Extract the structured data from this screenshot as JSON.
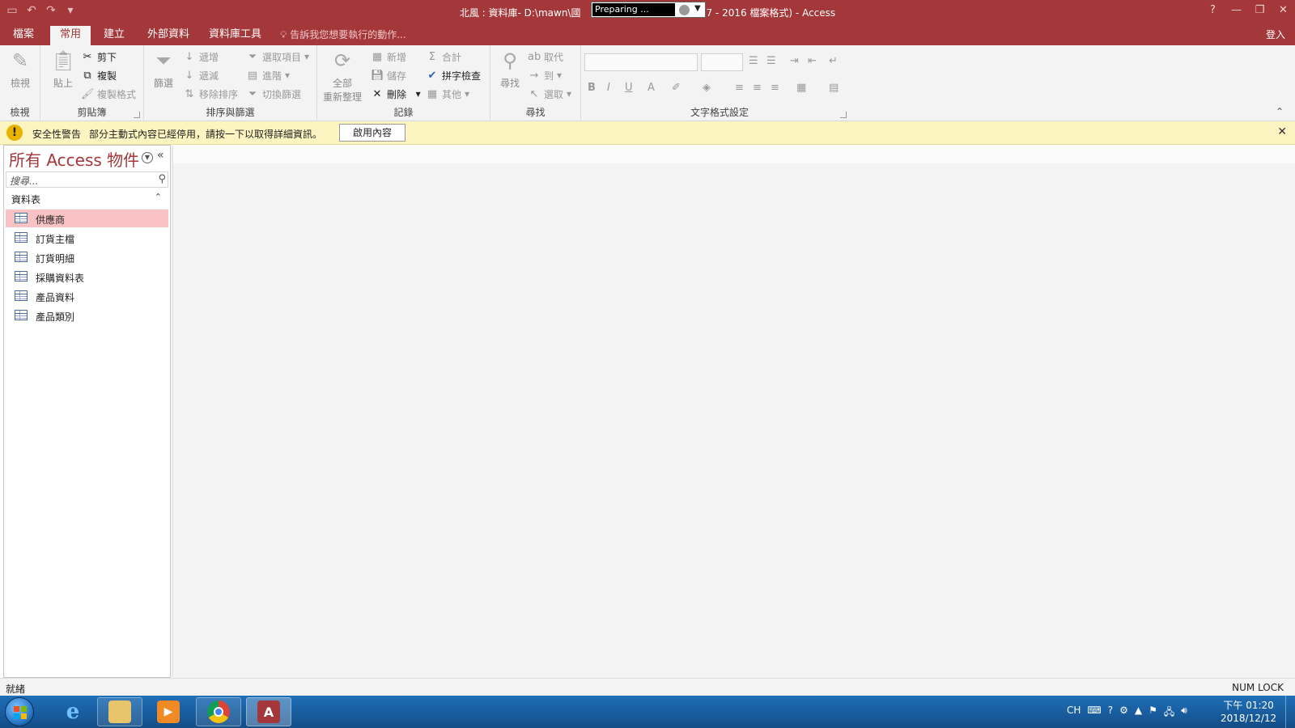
{
  "window": {
    "title_left": "北風 : 資料庫- D:\\mawn\\國",
    "title_right": "7 - 2016 檔案格式) - Access",
    "recorder_status": "Preparing ..."
  },
  "tabs": [
    "檔案",
    "常用",
    "建立",
    "外部資料",
    "資料庫工具"
  ],
  "active_tab": "常用",
  "tell_me": "告訴我您想要執行的動作...",
  "sign_in": "登入",
  "ribbon": {
    "view_group": {
      "view": "檢視",
      "label": "檢視"
    },
    "clipboard": {
      "paste": "貼上",
      "cut": "剪下",
      "copy": "複製",
      "format_painter": "複製格式",
      "label": "剪貼簿"
    },
    "sort_filter": {
      "filter": "篩選",
      "ascending": "遞增",
      "descending": "遞減",
      "remove_sort": "移除排序",
      "selection": "選取項目",
      "advanced": "進階",
      "toggle_filter": "切換篩選",
      "label": "排序與篩選"
    },
    "records": {
      "refresh_all_line1": "全部",
      "refresh_all_line2": "重新整理",
      "new": "新增",
      "save": "儲存",
      "delete": "刪除",
      "totals": "合計",
      "spelling": "拼字檢查",
      "more": "其他",
      "label": "記錄"
    },
    "find": {
      "find": "尋找",
      "replace": "取代",
      "goto": "到",
      "select": "選取",
      "label": "尋找"
    },
    "text_formatting": {
      "bold": "B",
      "italic": "I",
      "underline": "U",
      "font_color": "A",
      "label": "文字格式設定"
    }
  },
  "security_bar": {
    "title": "安全性警告",
    "message": "部分主動式內容已經停用，請按一下以取得詳細資訊。",
    "button": "啟用內容"
  },
  "nav": {
    "header": "所有 Access 物件",
    "search_placeholder": "搜尋...",
    "section": "資料表",
    "items": [
      "供應商",
      "訂貨主檔",
      "訂貨明細",
      "採購資料表",
      "產品資料",
      "產品類別"
    ],
    "selected": "供應商"
  },
  "status": {
    "left": "就緒",
    "right": "NUM LOCK"
  },
  "taskbar": {
    "tray_lang": "CH",
    "clock_time": "下午 01:20",
    "clock_date": "2018/12/12"
  }
}
